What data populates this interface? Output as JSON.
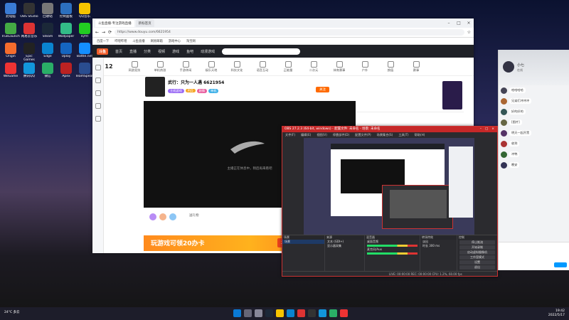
{
  "desktop": {
    "icons": [
      {
        "label": "此电脑",
        "color": "#3a7bd5"
      },
      {
        "label": "OBS Studio",
        "color": "#333"
      },
      {
        "label": "回收站",
        "color": "#777"
      },
      {
        "label": "控制面板",
        "color": "#2c6fbf"
      },
      {
        "label": "QQ音乐",
        "color": "#f5c400"
      },
      {
        "label": "TrueLauncher",
        "color": "#4a4"
      },
      {
        "label": "网易云音乐",
        "color": "#d33"
      },
      {
        "label": "Steam",
        "color": "#1b2838"
      },
      {
        "label": "Wallpaper",
        "color": "#3b8"
      },
      {
        "label": "iQIYI",
        "color": "#2c2"
      },
      {
        "label": "Origin",
        "color": "#f56c2d"
      },
      {
        "label": "Epic Games",
        "color": "#222"
      },
      {
        "label": "Edge",
        "color": "#0a84d0"
      },
      {
        "label": "Uplay",
        "color": "#1565c0"
      },
      {
        "label": "Battle.net",
        "color": "#148eff"
      },
      {
        "label": "WeGame",
        "color": "#e33"
      },
      {
        "label": "腾讯QQ",
        "color": "#1296db"
      },
      {
        "label": "微信",
        "color": "#2aae67"
      },
      {
        "label": "Apex",
        "color": "#b22"
      },
      {
        "label": "TeamSpeak",
        "color": "#2a4d8f"
      }
    ]
  },
  "browser": {
    "tabs": [
      {
        "label": "斗鱼直播-专注游戏直播"
      },
      {
        "label": "新标签页"
      }
    ],
    "address": "https://www.douyu.com/6621954",
    "bookmarks": [
      "百度一下",
      "哔哩哔哩",
      "斗鱼直播",
      "网易邮箱",
      "游戏中心",
      "淘宝网"
    ],
    "site": {
      "logo": "斗鱼",
      "nav": [
        "首页",
        "直播",
        "分类",
        "视频",
        "游戏",
        "鱼吧",
        "动漫游戏"
      ],
      "categories": [
        "网游竞技",
        "单机热游",
        "手游休闲",
        "娱乐天地",
        "科技文化",
        "语音互动",
        "正能量",
        "二次元",
        "体育赛事",
        "户外",
        "颜值",
        "赛事"
      ],
      "category_count": "12",
      "streamer_title": "武行：只为一人遇 6621954",
      "streamer_tags": [
        "主机游戏",
        "PS5",
        "剧情",
        "单机"
      ],
      "player_status": "主播正在休息中，稍后再来看吧",
      "follow_label": "关注",
      "banner_text": "玩游戏可领20办卡",
      "banner_badge": "20办卡",
      "gift_hint": "送礼物"
    }
  },
  "obs": {
    "title": "OBS 27.2.3 (64-bit, windows) - 配置文件: 未命名 - 场景: 未命名",
    "menu": [
      "文件(F)",
      "编辑(E)",
      "视图(V)",
      "停靠部件(D)",
      "配置文件(P)",
      "场景集合(S)",
      "工具(T)",
      "帮助(H)"
    ],
    "docks": {
      "scenes": {
        "title": "场景",
        "items": [
          "场景"
        ]
      },
      "sources": {
        "title": "来源",
        "items": [
          "文本 (GDI+)",
          "显示器采集"
        ]
      },
      "mixer": {
        "title": "混音器",
        "items": [
          "桌面音频",
          "麦克风/Aux"
        ]
      },
      "transitions": {
        "title": "转场特效",
        "items": [
          "淡出",
          "时长 300 ms"
        ]
      },
      "controls": {
        "title": "控制",
        "buttons": [
          "停止推流",
          "开始录制",
          "启动虚拟摄像机",
          "工作室模式",
          "设置",
          "退出"
        ]
      }
    },
    "status": "LIVE: 00:00:00  REC: 00:00:00  CPU: 1.2%, 60.00 fps"
  },
  "chat": {
    "name": "小七",
    "subtitle": "在线",
    "messages": [
      {
        "text": "哈哈哈哈"
      },
      {
        "text": "兄弟们冲冲冲"
      },
      {
        "text": "好的好的"
      },
      {
        "text": "[图片]"
      },
      {
        "text": "明天一起开黑"
      },
      {
        "text": "收到"
      },
      {
        "text": "冲鸭"
      },
      {
        "text": "晚安"
      }
    ]
  },
  "taskbar": {
    "weather": "24°C 多云",
    "time": "19:42",
    "date": "2022/5/17"
  }
}
